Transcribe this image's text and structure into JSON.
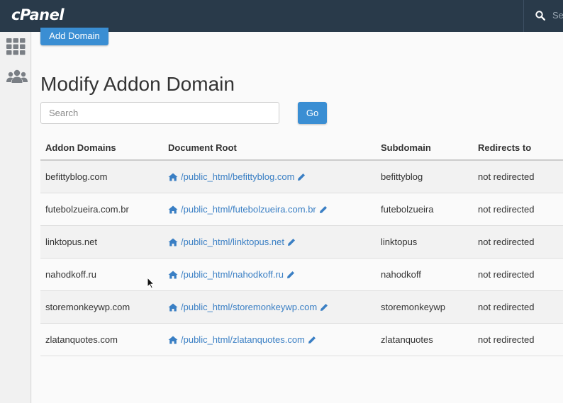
{
  "header": {
    "logo": "cPanel",
    "search_placeholder": "Sea"
  },
  "sidebar": {
    "items": [
      {
        "icon": "grid-icon"
      },
      {
        "icon": "users-icon"
      }
    ]
  },
  "toolbar": {
    "add_domain_label": "Add Domain"
  },
  "page": {
    "title": "Modify Addon Domain"
  },
  "search": {
    "placeholder": "Search",
    "go_label": "Go"
  },
  "table": {
    "columns": [
      "Addon Domains",
      "Document Root",
      "Subdomain",
      "Redirects to"
    ],
    "rows": [
      {
        "domain": "befittyblog.com",
        "docroot": "/public_html/befittyblog.com",
        "subdomain": "befittyblog",
        "redirect": "not redirected"
      },
      {
        "domain": "futebolzueira.com.br",
        "docroot": "/public_html/futebolzueira.com.br",
        "subdomain": "futebolzueira",
        "redirect": "not redirected"
      },
      {
        "domain": "linktopus.net",
        "docroot": "/public_html/linktopus.net",
        "subdomain": "linktopus",
        "redirect": "not redirected"
      },
      {
        "domain": "nahodkoff.ru",
        "docroot": "/public_html/nahodkoff.ru",
        "subdomain": "nahodkoff",
        "redirect": "not redirected"
      },
      {
        "domain": "storemonkeywp.com",
        "docroot": "/public_html/storemonkeywp.com",
        "subdomain": "storemonkeywp",
        "redirect": "not redirected"
      },
      {
        "domain": "zlatanquotes.com",
        "docroot": "/public_html/zlatanquotes.com",
        "subdomain": "zlatanquotes",
        "redirect": "not redirected"
      }
    ]
  },
  "colors": {
    "topbar": "#293a4a",
    "primary": "#3a8ed3",
    "link": "#3a7fc4"
  }
}
